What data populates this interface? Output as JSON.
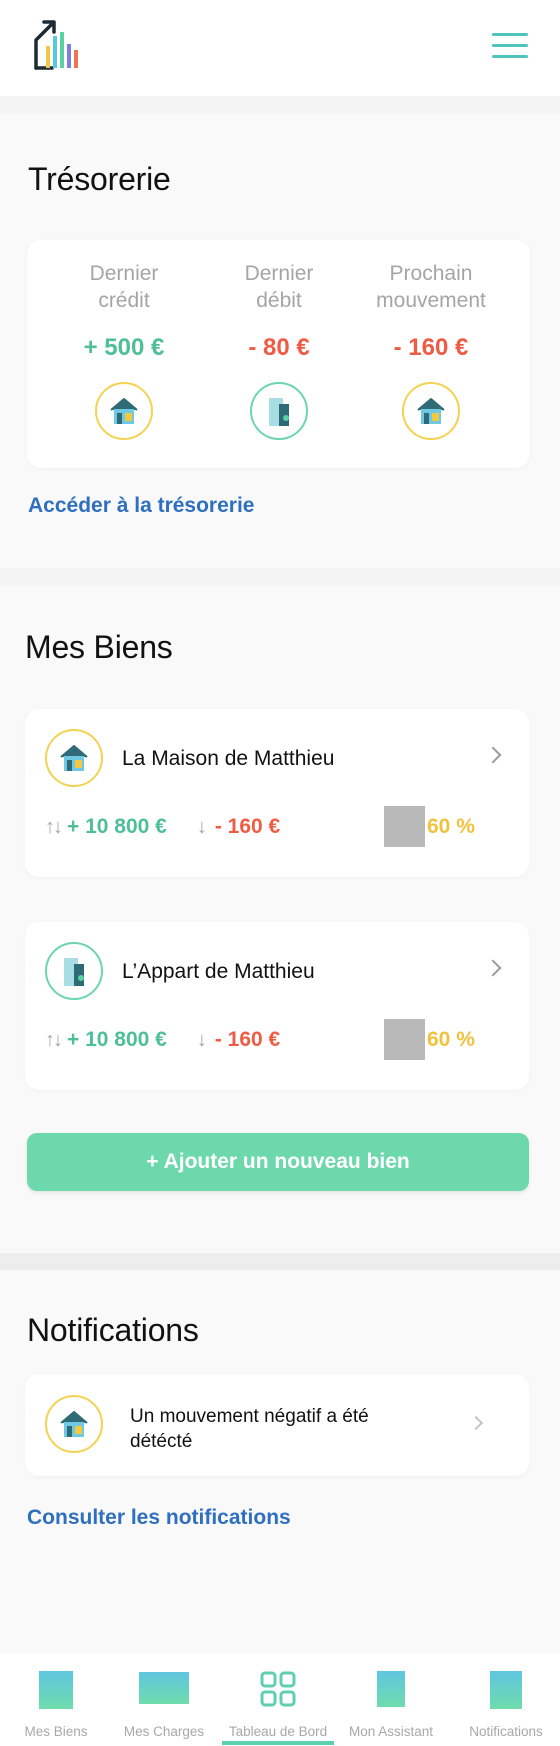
{
  "header": {
    "logo_icon": "house-bars-logo-icon",
    "menu_icon": "hamburger-menu-icon"
  },
  "tresorerie": {
    "title": "Trésorerie",
    "columns": [
      {
        "label_line1": "Dernier",
        "label_line2": "crédit",
        "amount": "+ 500 €",
        "icon": "house-icon"
      },
      {
        "label_line1": "Dernier",
        "label_line2": "débit",
        "amount": "- 80 €",
        "icon": "apartment-icon"
      },
      {
        "label_line1": "Prochain",
        "label_line2": "mouvement",
        "amount": "- 160 €",
        "icon": "house-icon"
      }
    ],
    "link": "Accéder à la trésorerie"
  },
  "biens": {
    "title": "Mes Biens",
    "items": [
      {
        "name": "La Maison de Matthieu",
        "arrows_both": "↑↓",
        "credit": "+ 10 800 €",
        "arrow_down": "↓",
        "debit": "- 160 €",
        "percent": "60 %",
        "icon": "house-icon"
      },
      {
        "name": "L’Appart de Matthieu",
        "arrows_both": "↑↓",
        "credit": "+ 10 800 €",
        "arrow_down": "↓",
        "debit": "- 160 €",
        "percent": "60 %",
        "icon": "apartment-icon"
      }
    ],
    "add_button": "+ Ajouter un nouveau bien"
  },
  "notifications": {
    "title": "Notifications",
    "item": {
      "text": "Un mouvement négatif a été détécté",
      "icon": "house-icon"
    },
    "link": "Consulter les notifications"
  },
  "tabbar": {
    "active": "Tableau de Bord",
    "tabs": [
      {
        "label": "Mes Biens"
      },
      {
        "label": "Mes Charges"
      },
      {
        "label": "Tableau de Bord"
      },
      {
        "label": "Mon Assistant"
      },
      {
        "label": "Notifications"
      }
    ]
  },
  "colors": {
    "positive": "#4ebf98",
    "negative": "#ef5b43",
    "percent": "#f2c23e",
    "link": "#2f6fc0",
    "accent": "#6ed8ad"
  }
}
